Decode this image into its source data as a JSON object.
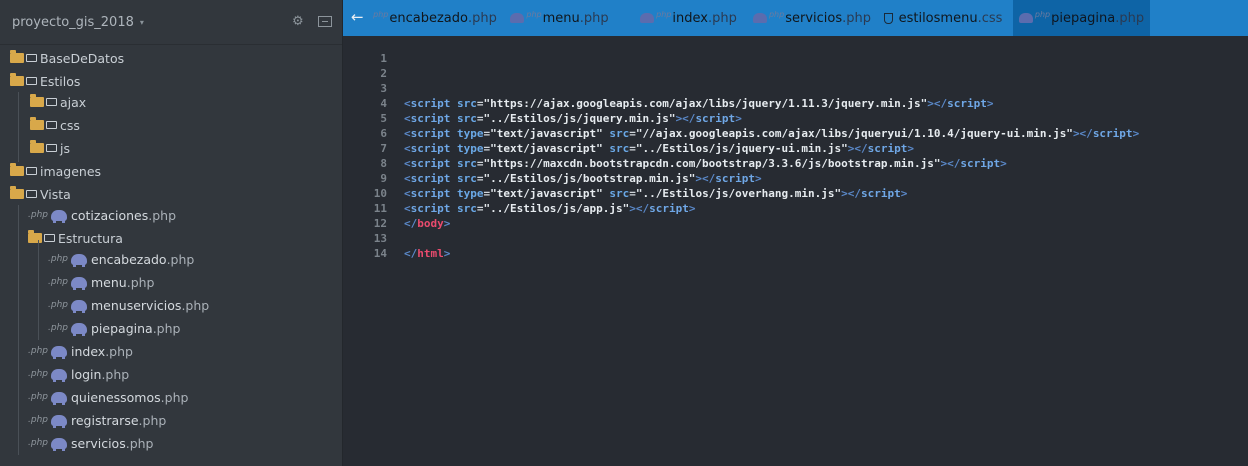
{
  "sidebar": {
    "project_name": "proyecto_gis_2018",
    "caret": "▾",
    "gear_glyph": "⚙",
    "items": [
      {
        "type": "folder",
        "label": "BaseDeDatos"
      },
      {
        "type": "folder-open",
        "label": "Estilos"
      },
      {
        "type": "folder",
        "label": "ajax"
      },
      {
        "type": "folder",
        "label": "css"
      },
      {
        "type": "folder",
        "label": "js"
      },
      {
        "type": "folder",
        "label": "imagenes"
      },
      {
        "type": "folder-open",
        "label": "Vista"
      },
      {
        "type": "php",
        "name": "cotizaciones",
        "ext": ".php"
      },
      {
        "type": "folder-open",
        "label": "Estructura"
      },
      {
        "type": "php",
        "name": "encabezado",
        "ext": ".php"
      },
      {
        "type": "php",
        "name": "menu",
        "ext": ".php"
      },
      {
        "type": "php",
        "name": "menuservicios",
        "ext": ".php"
      },
      {
        "type": "php",
        "name": "piepagina",
        "ext": ".php"
      },
      {
        "type": "php",
        "name": "index",
        "ext": ".php"
      },
      {
        "type": "php",
        "name": "login",
        "ext": ".php"
      },
      {
        "type": "php",
        "name": "quienessomos",
        "ext": ".php"
      },
      {
        "type": "php",
        "name": "registrarse",
        "ext": ".php"
      },
      {
        "type": "php",
        "name": "servicios",
        "ext": ".php"
      }
    ],
    "php_prefix": "php"
  },
  "tabs": {
    "back_glyph": "←",
    "php_prefix": "php",
    "items": [
      {
        "name": "encabezado",
        "ext": ".php",
        "kind": "php"
      },
      {
        "name": "menu",
        "ext": ".php",
        "kind": "php"
      },
      {
        "name": "index",
        "ext": ".php",
        "kind": "php"
      },
      {
        "name": "servicios",
        "ext": ".php",
        "kind": "php"
      },
      {
        "name": "estilosmenu",
        "ext": ".css",
        "kind": "css"
      },
      {
        "name": "piepagina",
        "ext": ".php",
        "kind": "php",
        "active": true
      }
    ]
  },
  "editor": {
    "line_numbers": [
      "1",
      "2",
      "3",
      "4",
      "5",
      "6",
      "7",
      "8",
      "9",
      "10",
      "11",
      "12",
      "13",
      "14"
    ],
    "lines": [
      [],
      [],
      [],
      [
        [
          "bracket",
          "<"
        ],
        [
          "tag",
          "script"
        ],
        [
          "sp",
          " "
        ],
        [
          "attr",
          "src"
        ],
        [
          "eq",
          "="
        ],
        [
          "str",
          "\"https://ajax.googleapis.com/ajax/libs/jquery/1.11.3/jquery.min.js\""
        ],
        [
          "bracket",
          "></"
        ],
        [
          "tag",
          "script"
        ],
        [
          "bracket",
          ">"
        ]
      ],
      [
        [
          "bracket",
          "<"
        ],
        [
          "tag",
          "script"
        ],
        [
          "sp",
          " "
        ],
        [
          "attr",
          "src"
        ],
        [
          "eq",
          "="
        ],
        [
          "str",
          "\"../Estilos/js/jquery.min.js\""
        ],
        [
          "bracket",
          "></"
        ],
        [
          "tag",
          "script"
        ],
        [
          "bracket",
          ">"
        ]
      ],
      [
        [
          "bracket",
          "<"
        ],
        [
          "tag",
          "script"
        ],
        [
          "sp",
          " "
        ],
        [
          "attr",
          "type"
        ],
        [
          "eq",
          "="
        ],
        [
          "str",
          "\"text/javascript\""
        ],
        [
          "sp",
          " "
        ],
        [
          "attr",
          "src"
        ],
        [
          "eq",
          "="
        ],
        [
          "str",
          "\"//ajax.googleapis.com/ajax/libs/jqueryui/1.10.4/jquery-ui.min.js\""
        ],
        [
          "bracket",
          "></"
        ],
        [
          "tag",
          "script"
        ],
        [
          "bracket",
          ">"
        ]
      ],
      [
        [
          "bracket",
          "<"
        ],
        [
          "tag",
          "script"
        ],
        [
          "sp",
          " "
        ],
        [
          "attr",
          "type"
        ],
        [
          "eq",
          "="
        ],
        [
          "str",
          "\"text/javascript\""
        ],
        [
          "sp",
          " "
        ],
        [
          "attr",
          "src"
        ],
        [
          "eq",
          "="
        ],
        [
          "str",
          "\"../Estilos/js/jquery-ui.min.js\""
        ],
        [
          "bracket",
          "></"
        ],
        [
          "tag",
          "script"
        ],
        [
          "bracket",
          ">"
        ]
      ],
      [
        [
          "bracket",
          "<"
        ],
        [
          "tag",
          "script"
        ],
        [
          "sp",
          " "
        ],
        [
          "attr",
          "src"
        ],
        [
          "eq",
          "="
        ],
        [
          "str",
          "\"https://maxcdn.bootstrapcdn.com/bootstrap/3.3.6/js/bootstrap.min.js\""
        ],
        [
          "bracket",
          "></"
        ],
        [
          "tag",
          "script"
        ],
        [
          "bracket",
          ">"
        ]
      ],
      [
        [
          "bracket",
          "<"
        ],
        [
          "tag",
          "script"
        ],
        [
          "sp",
          " "
        ],
        [
          "attr",
          "src"
        ],
        [
          "eq",
          "="
        ],
        [
          "str",
          "\"../Estilos/js/bootstrap.min.js\""
        ],
        [
          "bracket",
          "></"
        ],
        [
          "tag",
          "script"
        ],
        [
          "bracket",
          ">"
        ]
      ],
      [
        [
          "bracket",
          "<"
        ],
        [
          "tag",
          "script"
        ],
        [
          "sp",
          " "
        ],
        [
          "attr",
          "type"
        ],
        [
          "eq",
          "="
        ],
        [
          "str",
          "\"text/javascript\""
        ],
        [
          "sp",
          " "
        ],
        [
          "attr",
          "src"
        ],
        [
          "eq",
          "="
        ],
        [
          "str",
          "\"../Estilos/js/overhang.min.js\""
        ],
        [
          "bracket",
          "></"
        ],
        [
          "tag",
          "script"
        ],
        [
          "bracket",
          ">"
        ]
      ],
      [
        [
          "bracket",
          "<"
        ],
        [
          "tag",
          "script"
        ],
        [
          "sp",
          " "
        ],
        [
          "attr",
          "src"
        ],
        [
          "eq",
          "="
        ],
        [
          "str",
          "\"../Estilos/js/app.js\""
        ],
        [
          "bracket",
          "></"
        ],
        [
          "tag",
          "script"
        ],
        [
          "bracket",
          ">"
        ]
      ],
      [
        [
          "bracket",
          "</"
        ],
        [
          "red",
          "body"
        ],
        [
          "bracket",
          ">"
        ]
      ],
      [],
      [
        [
          "bracket",
          "</"
        ],
        [
          "red",
          "html"
        ],
        [
          "bracket",
          ">"
        ]
      ]
    ]
  },
  "colors": {
    "tabbar_bg": "#2080c8",
    "active_tab_bg": "#0e64a6",
    "sidebar_bg": "#32373d",
    "editor_bg": "#272b32",
    "folder": "#d8a84a",
    "php_icon": "#7c89c6",
    "closing_tag_red": "#e94b6e"
  }
}
